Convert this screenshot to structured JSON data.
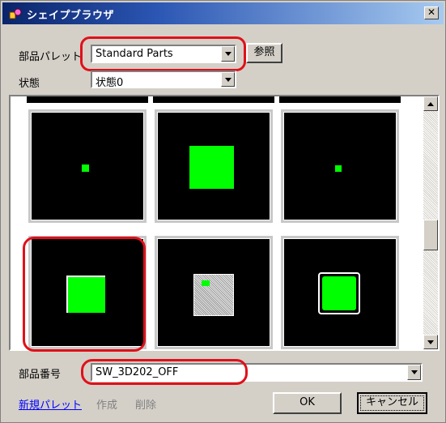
{
  "window": {
    "title": "シェイプブラウザ",
    "close_glyph": "✕"
  },
  "palette": {
    "label": "部品パレット",
    "value": "Standard Parts",
    "browse_label": "参照"
  },
  "state": {
    "label": "状態",
    "value": "状態0"
  },
  "part_number": {
    "label": "部品番号",
    "value": "SW_3D202_OFF"
  },
  "footer": {
    "new_palette": "新規パレット",
    "create": "作成",
    "delete": "削除",
    "ok": "OK",
    "cancel": "キャンセル"
  },
  "tiles": [
    {
      "shape": "tiny-square",
      "selected": false
    },
    {
      "shape": "large-square",
      "selected": false
    },
    {
      "shape": "tiny-square",
      "selected": false
    },
    {
      "shape": "shaded-square",
      "selected": true
    },
    {
      "shape": "dithered-square-with-green-corner",
      "selected": false
    },
    {
      "shape": "rounded-square-outline",
      "selected": false
    }
  ],
  "colors": {
    "accent_green": "#00ff00",
    "highlight_red": "#e0101a",
    "link_blue": "#0000ff"
  }
}
